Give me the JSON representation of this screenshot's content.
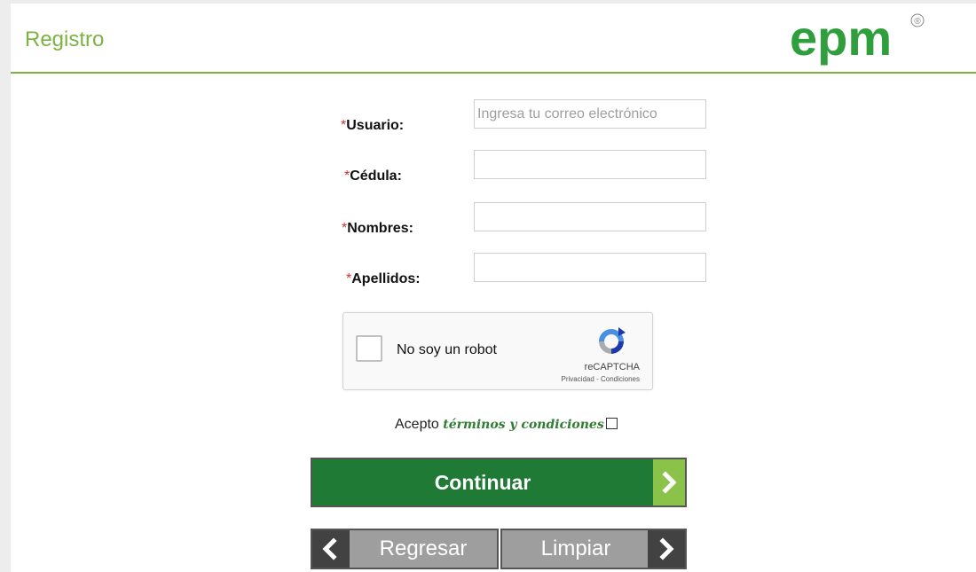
{
  "header": {
    "title": "Registro",
    "logo_text": "epm",
    "logo_mark": "®",
    "brand_color": "#7cb342"
  },
  "form": {
    "fields": [
      {
        "required_mark": "*",
        "label": "Usuario:",
        "value": "",
        "placeholder": "Ingresa tu correo electrónico"
      },
      {
        "required_mark": "*",
        "label": "Cédula:",
        "value": "",
        "placeholder": ""
      },
      {
        "required_mark": "*",
        "label": "Nombres:",
        "value": "",
        "placeholder": ""
      },
      {
        "required_mark": "*",
        "label": "Apellidos:",
        "value": "",
        "placeholder": ""
      }
    ]
  },
  "captcha": {
    "label": "No soy un robot",
    "brand": "reCAPTCHA",
    "links": "Privacidad - Condiciones",
    "checked": false
  },
  "terms": {
    "prefix": "Acepto",
    "link": "términos y condiciones",
    "checked": false
  },
  "buttons": {
    "continue_label": "Continuar",
    "back_label": "Regresar",
    "clear_label": "Limpiar"
  },
  "icons": {
    "continue_arrow": "chevron-right-icon",
    "back_arrow": "chevron-left-icon",
    "clear_arrow": "chevron-right-icon",
    "captcha_logo": "recaptcha-icon"
  },
  "colors": {
    "primary_button": "#1f7a35",
    "accent": "#8bc34a",
    "secondary_button": "#9e9e9e",
    "required": "#d32f2f"
  }
}
